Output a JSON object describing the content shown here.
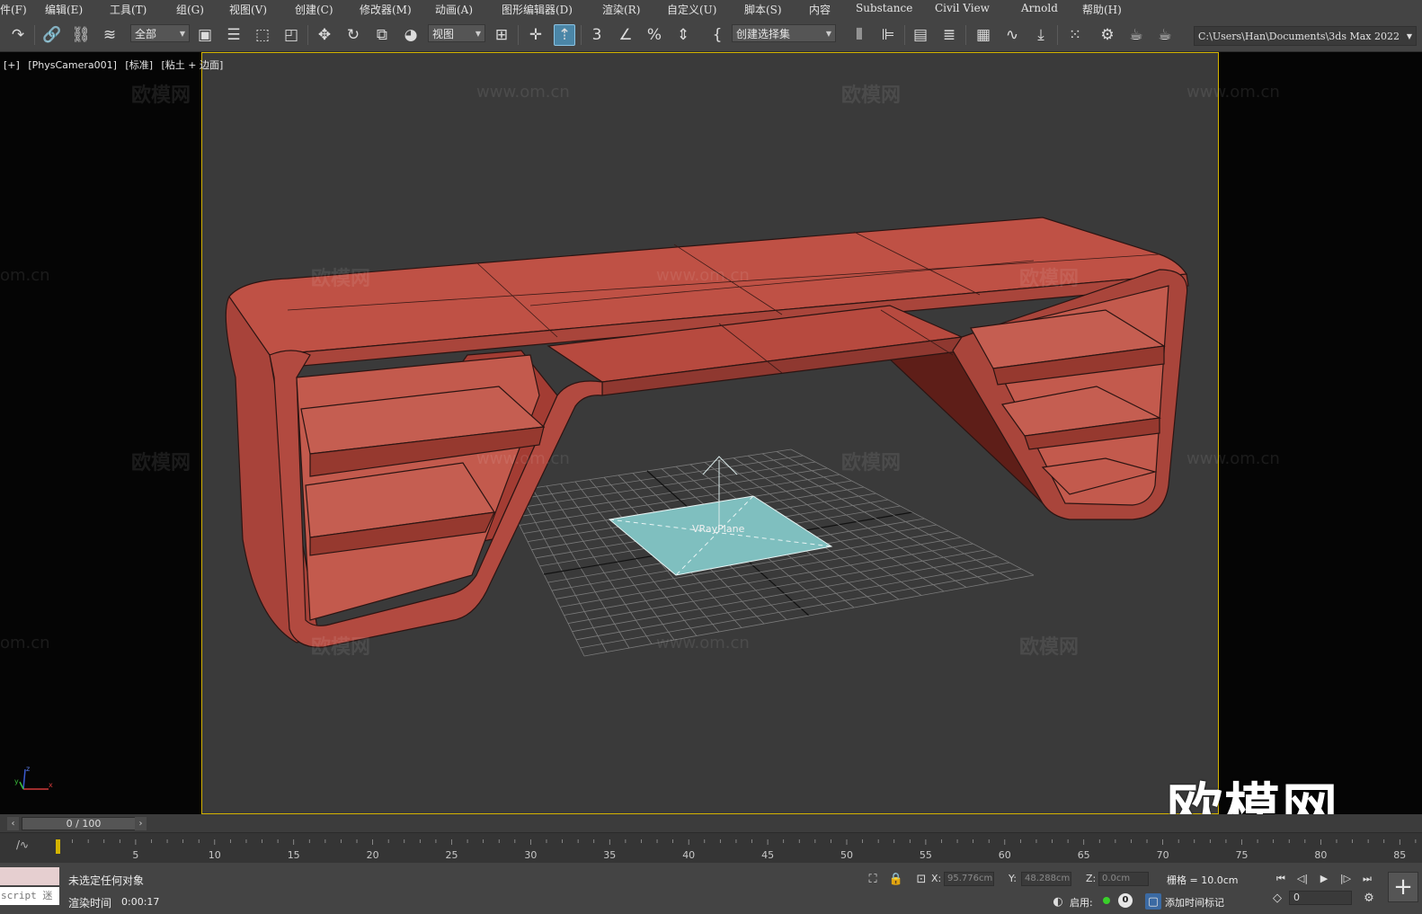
{
  "menu": [
    "件(F)",
    "编辑(E)",
    "工具(T)",
    "组(G)",
    "视图(V)",
    "创建(C)",
    "修改器(M)",
    "动画(A)",
    "图形编辑器(D)",
    "渲染(R)",
    "自定义(U)",
    "脚本(S)",
    "内容",
    "Substance",
    "Civil View",
    "Arnold",
    "帮助(H)"
  ],
  "toolbar": {
    "selection_filter": "全部",
    "ref_coord": "视图",
    "named_selection": "创建选择集",
    "project_path": "C:\\Users\\Han\\Documents\\3ds Max 2022",
    "icons": [
      "undo-icon",
      "link-icon",
      "unlink-icon",
      "bind-space-warp-icon",
      "select-object-icon",
      "select-by-name-icon",
      "rect-selection-icon",
      "window-crossing-icon",
      "move-icon",
      "rotate-icon",
      "scale-icon",
      "placement-icon",
      "use-pivot-icon",
      "snap-toggle-icon",
      "angle-snap-icon",
      "percent-snap-icon",
      "spinner-snap-icon",
      "edit-named-sel-icon",
      "mirror-icon",
      "align-icon",
      "scene-explorer-icon",
      "layer-explorer-icon",
      "toggle-ribbon-icon",
      "curve-editor-icon",
      "schematic-view-icon",
      "material-editor-icon",
      "render-setup-icon",
      "rendered-frame-icon",
      "render-production-icon"
    ]
  },
  "viewport": {
    "label_plus": "[+]",
    "label_camera": "[PhysCamera001]",
    "label_shading": "[标准]",
    "label_mode": "[粘土 + 边面]",
    "object_label": "VRayPlane",
    "border_color": "#d4b400",
    "furniture_color": "#b5473c",
    "plane_color": "#7fbfbf",
    "watermark_brand": "欧模网",
    "watermark_url": "www.om.cn",
    "watermark_url_cut": "om.cn"
  },
  "timeline": {
    "slider_text": "0 / 100",
    "ticks": [
      "5",
      "10",
      "15",
      "20",
      "25",
      "30",
      "35",
      "40",
      "45",
      "50",
      "55",
      "60",
      "65",
      "70",
      "75",
      "80",
      "85"
    ]
  },
  "status": {
    "maxscript_hint": "script 迷",
    "selection_status": "未选定任何对象",
    "render_time_label": "渲染时间",
    "render_time_value": "0:00:17",
    "x_label": "X:",
    "x_value": "95.776cm",
    "y_label": "Y:",
    "y_value": "48.288cm",
    "z_label": "Z:",
    "z_value": "0.0cm",
    "grid": "栅格 = 10.0cm",
    "enable_label": "启用:",
    "enable_count": "0",
    "add_time_tag": "添加时间标记",
    "current_frame": "0"
  }
}
